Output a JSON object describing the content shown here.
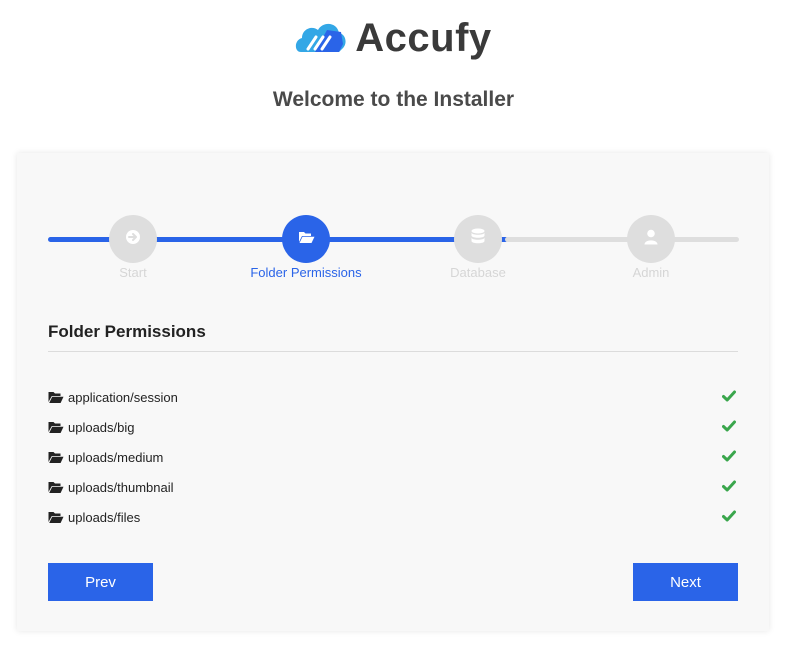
{
  "brand": {
    "name": "Accufy",
    "icon": "cloud-logo-icon",
    "colors": {
      "primary": "#2a64e8",
      "light": "#33a7e6"
    }
  },
  "page_title": "Welcome to the Installer",
  "steps": [
    {
      "label": "Start",
      "icon": "arrow-right-circle-icon",
      "state": "complete"
    },
    {
      "label": "Folder Permissions",
      "icon": "folder-open-icon",
      "state": "active"
    },
    {
      "label": "Database",
      "icon": "database-icon",
      "state": "pending"
    },
    {
      "label": "Admin",
      "icon": "user-icon",
      "state": "pending"
    }
  ],
  "section": {
    "title": "Folder Permissions",
    "folders": [
      {
        "path": "application/session",
        "status": "ok"
      },
      {
        "path": "uploads/big",
        "status": "ok"
      },
      {
        "path": "uploads/medium",
        "status": "ok"
      },
      {
        "path": "uploads/thumbnail",
        "status": "ok"
      },
      {
        "path": "uploads/files",
        "status": "ok"
      }
    ]
  },
  "buttons": {
    "prev": "Prev",
    "next": "Next"
  },
  "colors": {
    "accent": "#2a64e8",
    "inactive": "#dedede",
    "success": "#3aa64c"
  }
}
